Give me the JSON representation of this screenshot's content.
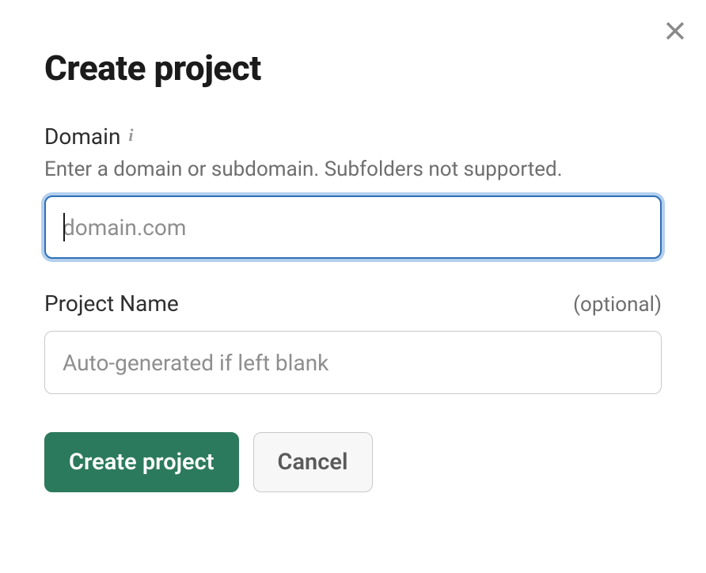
{
  "modal": {
    "title": "Create project",
    "domain": {
      "label": "Domain",
      "hint": "Enter a domain or subdomain. Subfolders not supported.",
      "placeholder": "domain.com",
      "value": ""
    },
    "projectName": {
      "label": "Project Name",
      "optional": "(optional)",
      "placeholder": "Auto-generated if left blank",
      "value": ""
    },
    "buttons": {
      "create": "Create project",
      "cancel": "Cancel"
    }
  }
}
